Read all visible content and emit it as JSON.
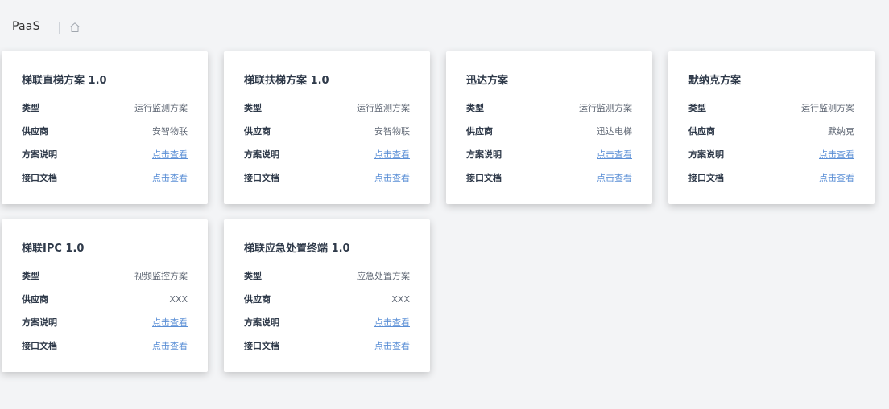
{
  "header": {
    "brand": "PaaS",
    "home_icon": "home-icon"
  },
  "labels": {
    "type": "类型",
    "vendor": "供应商",
    "description": "方案说明",
    "api_doc": "接口文档"
  },
  "cards": [
    {
      "title": "梯联直梯方案 1.0",
      "type": "运行监测方案",
      "vendor": "安智物联",
      "description_link": "点击查看",
      "api_doc_link": "点击查看"
    },
    {
      "title": "梯联扶梯方案 1.0",
      "type": "运行监测方案",
      "vendor": "安智物联",
      "description_link": "点击查看",
      "api_doc_link": "点击查看"
    },
    {
      "title": "迅达方案",
      "type": "运行监测方案",
      "vendor": "迅达电梯",
      "description_link": "点击查看",
      "api_doc_link": "点击查看"
    },
    {
      "title": "默纳克方案",
      "type": "运行监测方案",
      "vendor": "默纳克",
      "description_link": "点击查看",
      "api_doc_link": "点击查看"
    },
    {
      "title": "梯联IPC 1.0",
      "type": "视频监控方案",
      "vendor": "XXX",
      "description_link": "点击查看",
      "api_doc_link": "点击查看"
    },
    {
      "title": "梯联应急处置终端 1.0",
      "type": "应急处置方案",
      "vendor": "XXX",
      "description_link": "点击查看",
      "api_doc_link": "点击查看"
    }
  ],
  "colors": {
    "background": "#f3f4f6",
    "card": "#ffffff",
    "title_text": "#2f3a4a",
    "value_text": "#606875",
    "link": "#5b8fd6"
  }
}
